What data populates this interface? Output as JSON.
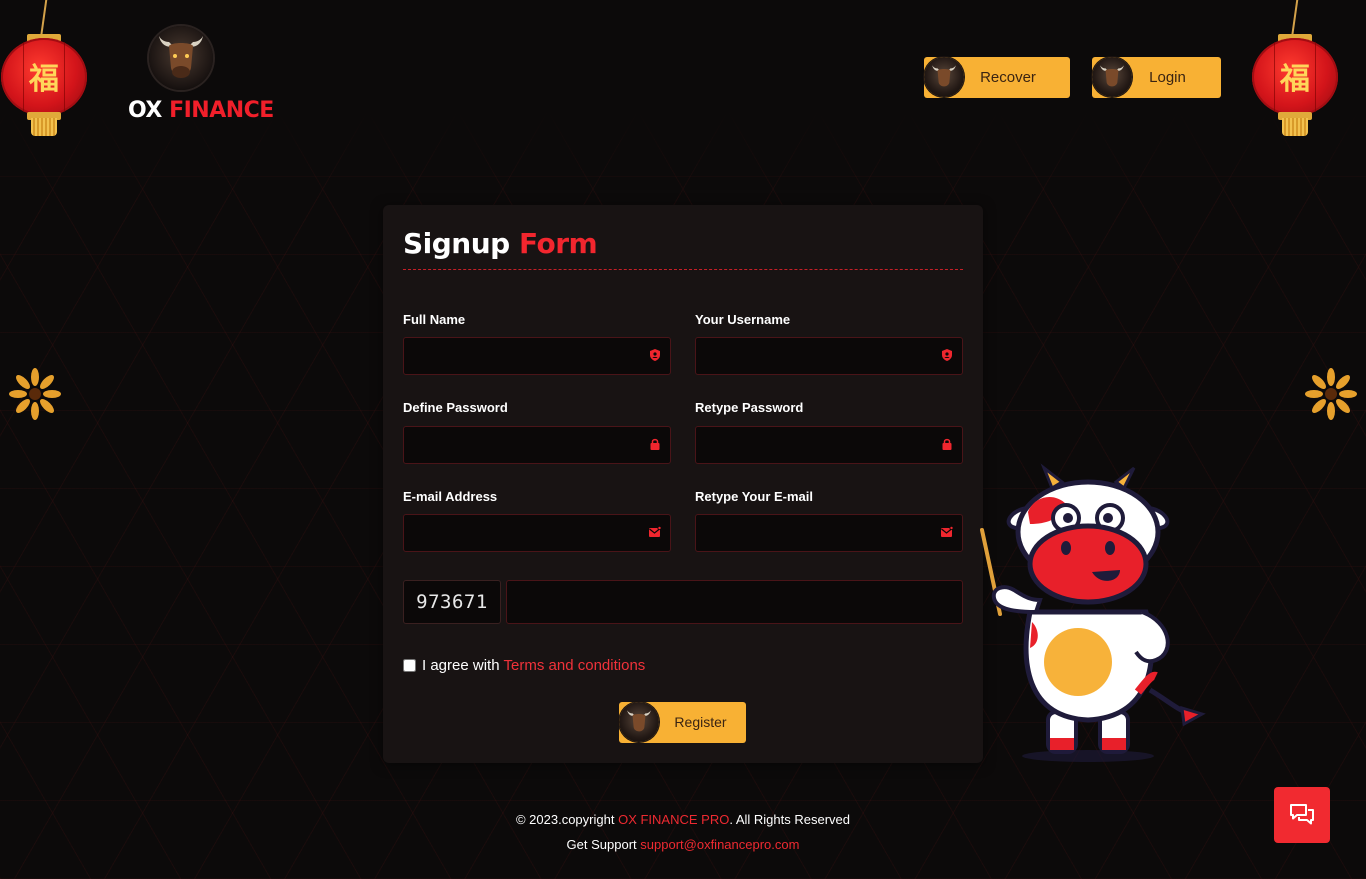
{
  "brand": {
    "name_part1": "OX",
    "name_part2": "FINANCE",
    "lantern_glyph": "福"
  },
  "header": {
    "recover_label": "Recover",
    "login_label": "Login"
  },
  "form": {
    "title_part1": "Signup",
    "title_part2": "Form",
    "fields": [
      {
        "label": "Full Name",
        "value": "",
        "icon": "user-shield-icon"
      },
      {
        "label": "Your Username",
        "value": "",
        "icon": "user-shield-icon"
      },
      {
        "label": "Define Password",
        "value": "",
        "icon": "lock-icon"
      },
      {
        "label": "Retype Password",
        "value": "",
        "icon": "lock-icon"
      },
      {
        "label": "E-mail Address",
        "value": "",
        "icon": "mail-icon"
      },
      {
        "label": "Retype Your E-mail",
        "value": "",
        "icon": "mail-icon"
      }
    ],
    "captcha_code": "973671",
    "captcha_value": "",
    "agree_text": "I agree with",
    "terms_link": "Terms and conditions",
    "agree_checked": false,
    "register_label": "Register"
  },
  "footer": {
    "copyright_prefix": "© 2023.copyright",
    "copyright_brand": "OX FINANCE PRO",
    "copyright_suffix": ". All Rights Reserved",
    "support_prefix": "Get Support",
    "support_email": "support@oxfinancepro.com"
  },
  "colors": {
    "accent_red": "#f2262e",
    "button_yellow": "#f8b134",
    "background": "#0c0a0a",
    "card": "#181313"
  },
  "icons": {
    "chat": "chat-bubbles-icon",
    "checkbox": "checkbox-icon"
  }
}
